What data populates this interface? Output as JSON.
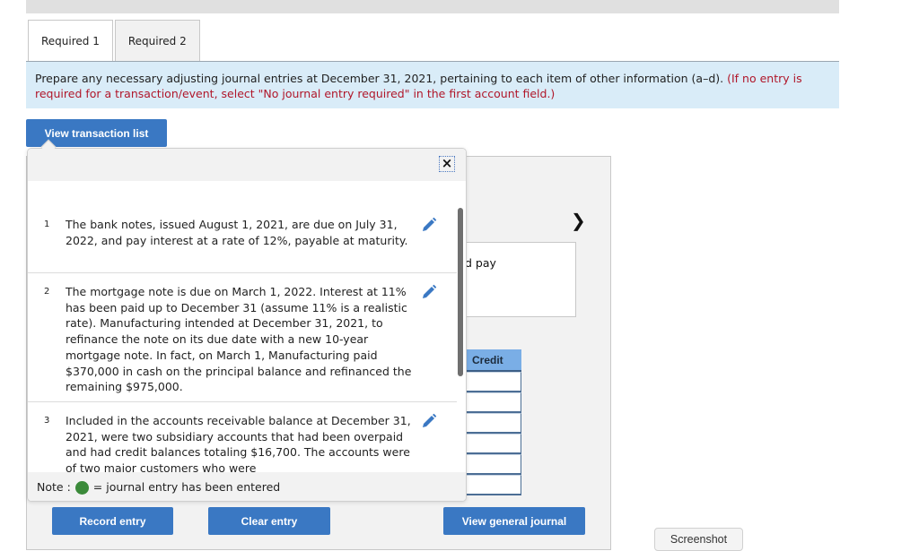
{
  "tabs": [
    {
      "label": "Required 1",
      "active": true
    },
    {
      "label": "Required 2",
      "active": false
    }
  ],
  "instructions": {
    "main": "Prepare any necessary adjusting journal entries at December 31, 2021, pertaining to each item of other information (a–d).",
    "note": "(If no entry is required for a transaction/event, select \"No journal entry required\" in the first account field.)"
  },
  "buttons": {
    "view_transaction_list": "View transaction list",
    "record_entry": "Record entry",
    "clear_entry": "Clear entry",
    "view_general_journal": "View general journal",
    "screenshot": "Screenshot"
  },
  "journal": {
    "description_fragment": "d pay",
    "credit_header": "Credit",
    "credit_rows": 6
  },
  "transaction_list": {
    "close_label": "×",
    "items": [
      {
        "num": "1",
        "text": "The bank notes, issued August 1, 2021, are due on July 31, 2022, and pay interest at a rate of 12%, payable at maturity."
      },
      {
        "num": "2",
        "text": "The mortgage note is due on March 1, 2022. Interest at 11% has been paid up to December 31 (assume 11% is a realistic rate). Manufacturing intended at December 31, 2021, to refinance the note on its due date with a new 10-year mortgage note. In fact, on March 1, Manufacturing paid $370,000 in cash on the principal balance and refinanced the remaining $975,000."
      },
      {
        "num": "3",
        "text": "Included in the accounts receivable balance at December 31, 2021, were two subsidiary accounts that had been overpaid and had credit balances totaling $16,700. The accounts were of two major customers who were"
      }
    ],
    "note_label": "Note :",
    "note_text": "= journal entry has been entered"
  },
  "colors": {
    "primary_button": "#3a78c3",
    "entered_indicator": "#3b8a3a",
    "instruction_bg": "#d9ecf8",
    "instruction_red": "#b0172a"
  }
}
